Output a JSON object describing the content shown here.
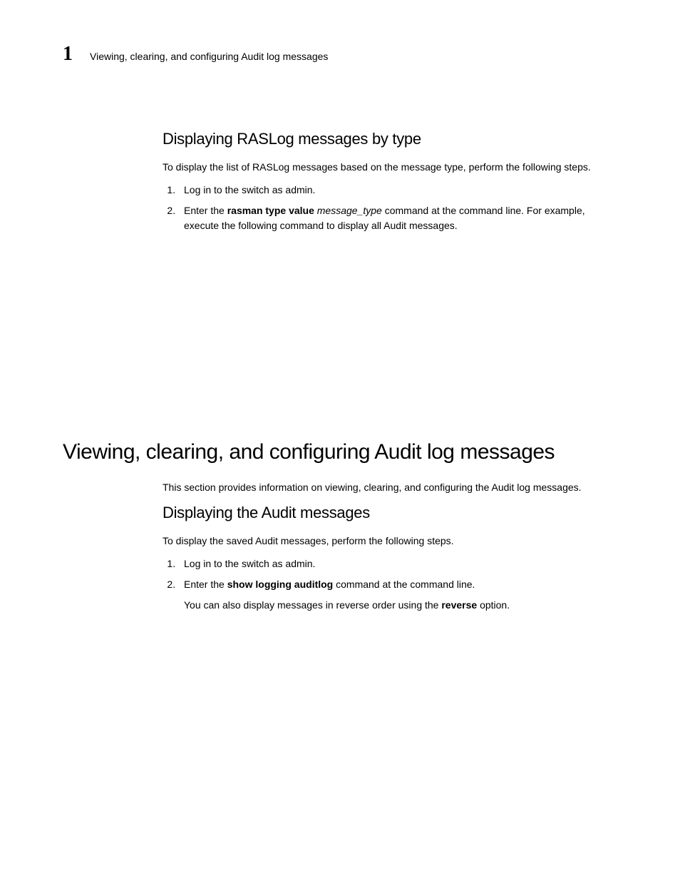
{
  "header": {
    "chapter_number": "1",
    "running_title": "Viewing, clearing, and configuring Audit log messages"
  },
  "section1": {
    "heading": "Displaying RASLog messages by type",
    "intro": "To display the list of RASLog messages based on the message type, perform the following steps.",
    "step1": "Log in to the switch as admin.",
    "step2_pre": "Enter the ",
    "step2_cmd": "rasman type value",
    "step2_arg": " message_type",
    "step2_post": " command at the command line. For example, execute the following command to display all Audit messages."
  },
  "section2": {
    "heading": "Viewing, clearing, and configuring Audit log messages",
    "intro": "This section provides information on viewing, clearing, and configuring the Audit log messages.",
    "sub_heading": "Displaying the Audit messages",
    "sub_intro": "To display the saved Audit messages, perform the following steps.",
    "step1": "Log in to the switch as admin.",
    "step2_pre": "Enter the ",
    "step2_cmd": "show logging auditlog",
    "step2_post": " command at the command line.",
    "step2_note_pre": "You can also display messages in reverse order using the ",
    "step2_note_bold": "reverse",
    "step2_note_post": " option."
  }
}
